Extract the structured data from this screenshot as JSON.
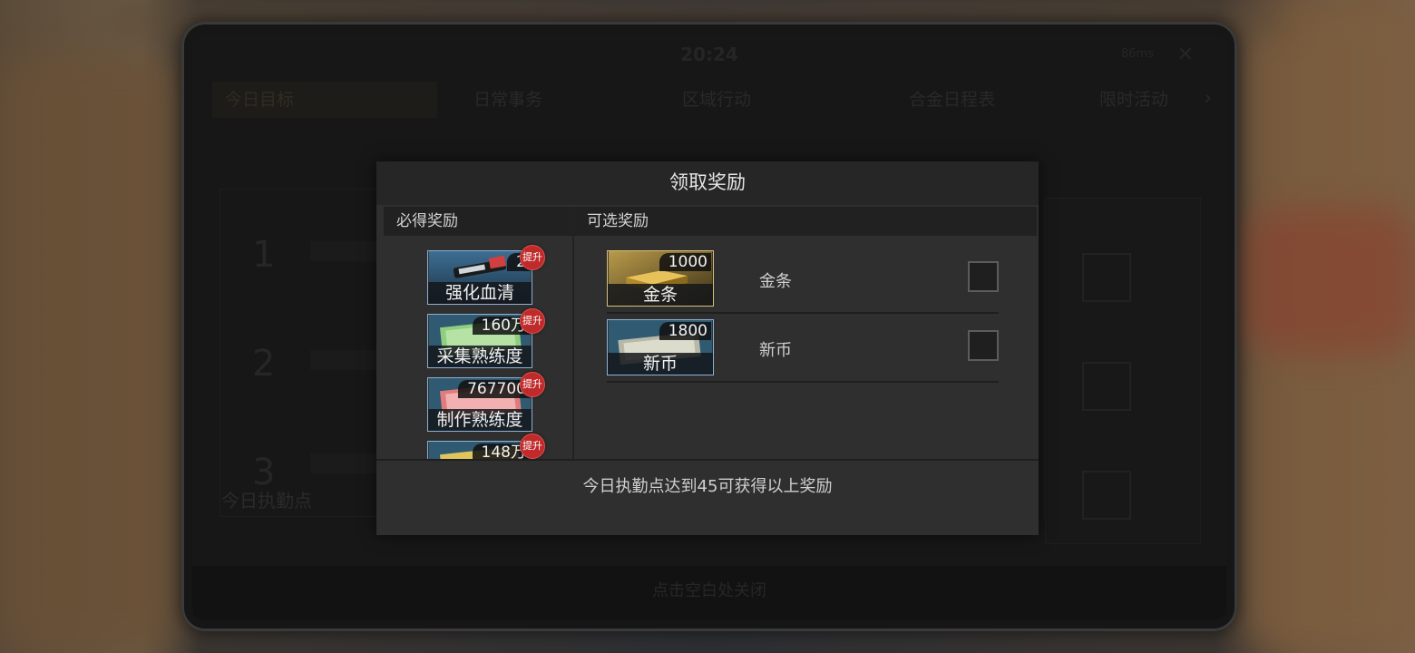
{
  "background": {
    "status_time": "20:24",
    "status_right": "86ms",
    "tabs": [
      "今日目标",
      "日常事务",
      "区域行动",
      "合金日程表",
      "限时活动"
    ],
    "today_points_label": "今日执勤点",
    "footer_hint": "点击空白处关闭",
    "row_numbers": [
      "1",
      "2",
      "3"
    ]
  },
  "modal": {
    "title": "领取奖励",
    "required_section": "必得奖励",
    "optional_section": "可选奖励",
    "up_badge": "提升",
    "required_items": [
      {
        "name": "强化血清",
        "qty": "2",
        "icon": "serum-vials-icon"
      },
      {
        "name": "采集熟练度",
        "qty": "160万",
        "icon": "green-banknote-icon"
      },
      {
        "name": "制作熟练度",
        "qty": "767700",
        "icon": "red-banknote-icon"
      },
      {
        "name": "",
        "qty": "148万",
        "icon": "yellow-banknote-icon"
      }
    ],
    "optional_items": [
      {
        "card_label": "金条",
        "qty": "1000",
        "name": "金条",
        "icon": "gold-bars-icon"
      },
      {
        "card_label": "新币",
        "qty": "1800",
        "name": "新币",
        "icon": "cash-stack-icon"
      }
    ],
    "footer_text": "今日执勤点达到45可获得以上奖励"
  },
  "colors": {
    "badge_red": "#c02a2a",
    "card_border_blue": "#8db2d6",
    "card_border_gold": "#d9c17a"
  }
}
